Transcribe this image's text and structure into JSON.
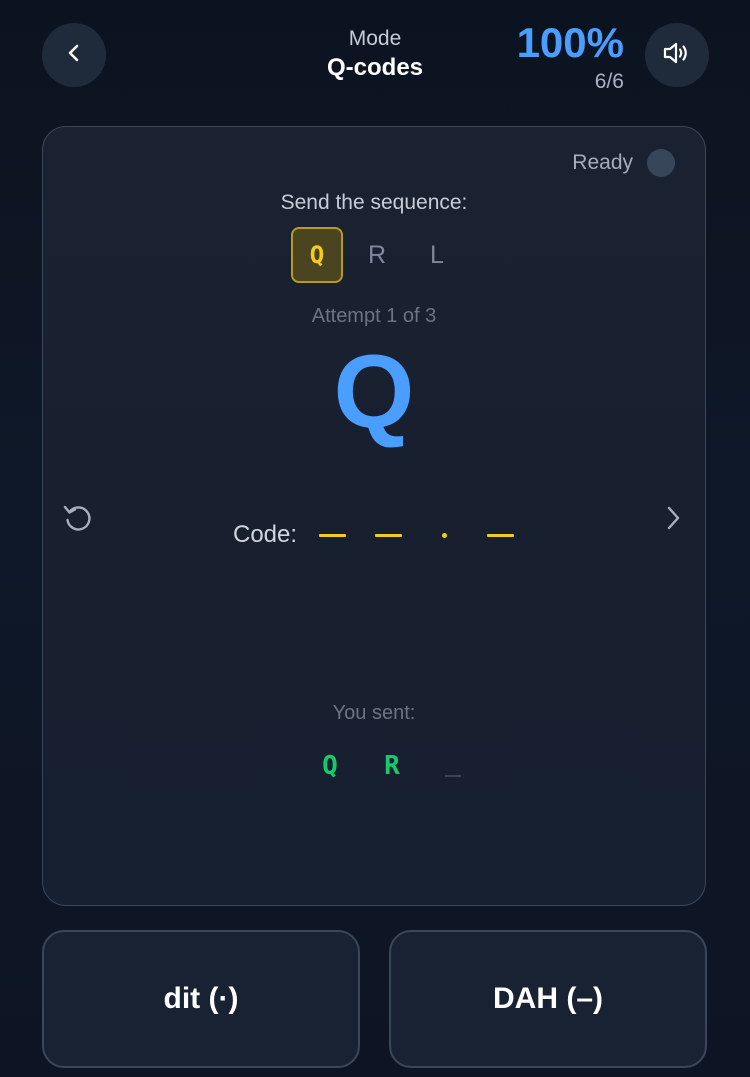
{
  "header": {
    "mode_label": "Mode",
    "mode_value": "Q-codes",
    "score_percent": "100%",
    "score_count": "6/6",
    "icons": {
      "back": "chevron-left-icon",
      "sound": "speaker-icon"
    }
  },
  "card": {
    "status_label": "Ready",
    "prompt": "Send the sequence:",
    "sequence": [
      "Q",
      "R",
      "L"
    ],
    "active_index": 0,
    "attempt": "Attempt 1 of 3",
    "current_letter": "Q",
    "code_label": "Code:",
    "code_symbols": [
      "dah",
      "dah",
      "dit",
      "dah"
    ],
    "sent_label": "You sent:",
    "sent": [
      "Q",
      "R"
    ],
    "icons": {
      "reset": "reset-icon",
      "next": "chevron-right-icon"
    }
  },
  "keys": {
    "dit_label": "dit (·)",
    "dah_label": "DAH (–)"
  },
  "colors": {
    "accent_blue": "#4a9eff",
    "code_yellow": "#f5cc1a",
    "sent_green": "#18c96b",
    "background": "#0f1828"
  }
}
